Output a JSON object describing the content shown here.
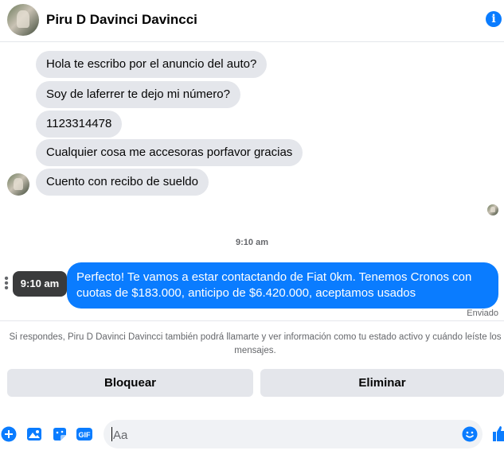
{
  "header": {
    "contact_name": "Piru D Davinci Davincci"
  },
  "messages_in": [
    "Hola te escribo por el anuncio del auto?",
    "Soy de laferrer te dejo mi número?",
    "1123314478",
    "Cualquier cosa me accesoras porfavor gracias",
    "Cuento con recibo de sueldo"
  ],
  "timestamp": "9:10 am",
  "message_out": "Perfecto! Te vamos a estar contactando de Fiat 0km. Tenemos Cronos con cuotas de $183.000, anticipo de $6.420.000, aceptamos usados",
  "tooltip": "9:10 am",
  "status": "Enviado",
  "notice": "Si respondes, Piru D Davinci Davincci también podrá llamarte y ver información como tu estado activo y cuándo leíste los mensajes.",
  "actions": {
    "block": "Bloquear",
    "delete": "Eliminar"
  },
  "composer": {
    "placeholder": "Aa"
  },
  "colors": {
    "accent": "#0a7cff",
    "bubble_in": "#e4e6eb",
    "muted": "#65676b"
  },
  "icons": [
    "info-icon",
    "plus-icon",
    "image-icon",
    "sticker-icon",
    "gif-icon",
    "emoji-icon",
    "like-icon",
    "more-icon"
  ]
}
